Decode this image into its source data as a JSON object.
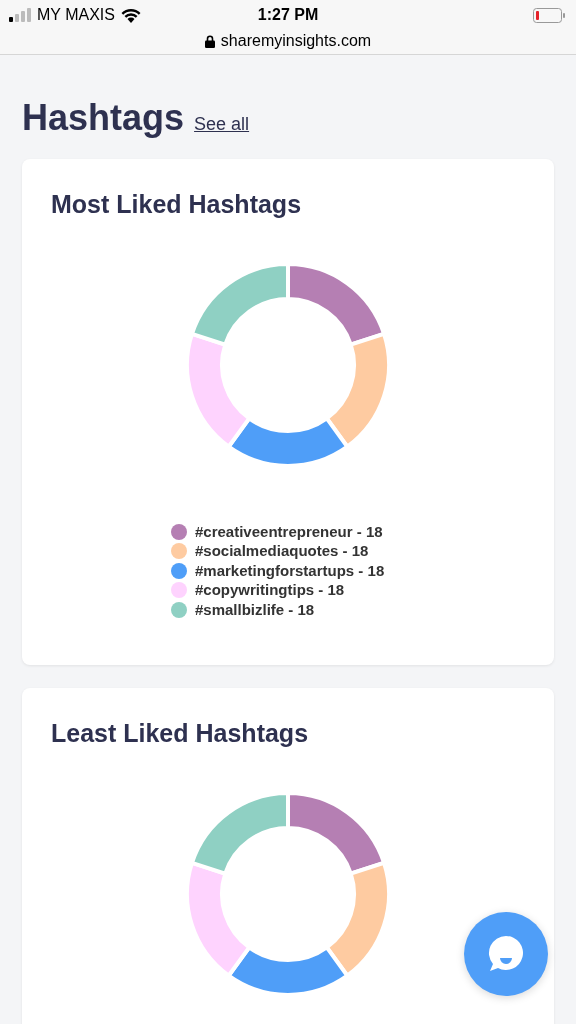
{
  "status_bar": {
    "carrier": "MY MAXIS",
    "time": "1:27 PM"
  },
  "address_bar": {
    "url": "sharemyinsights.com"
  },
  "heading": {
    "title": "Hashtags",
    "link": "See all"
  },
  "cards": [
    {
      "title": "Most Liked Hashtags",
      "slices": [
        {
          "color": "#b57fb3"
        },
        {
          "color": "#fecba1"
        },
        {
          "color": "#4f9ef8"
        },
        {
          "color": "#fed3fe"
        },
        {
          "color": "#8fd0c3"
        }
      ],
      "legend": [
        {
          "label": "#creativeentrepreneur - 18",
          "color": "#b57fb3"
        },
        {
          "label": "#socialmediaquotes - 18",
          "color": "#fecba1"
        },
        {
          "label": "#marketingforstartups - 18",
          "color": "#4f9ef8"
        },
        {
          "label": "#copywritingtips - 18",
          "color": "#fed3fe"
        },
        {
          "label": "#smallbizlife - 18",
          "color": "#8fd0c3"
        }
      ]
    },
    {
      "title": "Least Liked Hashtags",
      "slices": [
        {
          "color": "#b57fb3"
        },
        {
          "color": "#fecba1"
        },
        {
          "color": "#4f9ef8"
        },
        {
          "color": "#fed3fe"
        },
        {
          "color": "#8fd0c3"
        }
      ]
    }
  ]
}
